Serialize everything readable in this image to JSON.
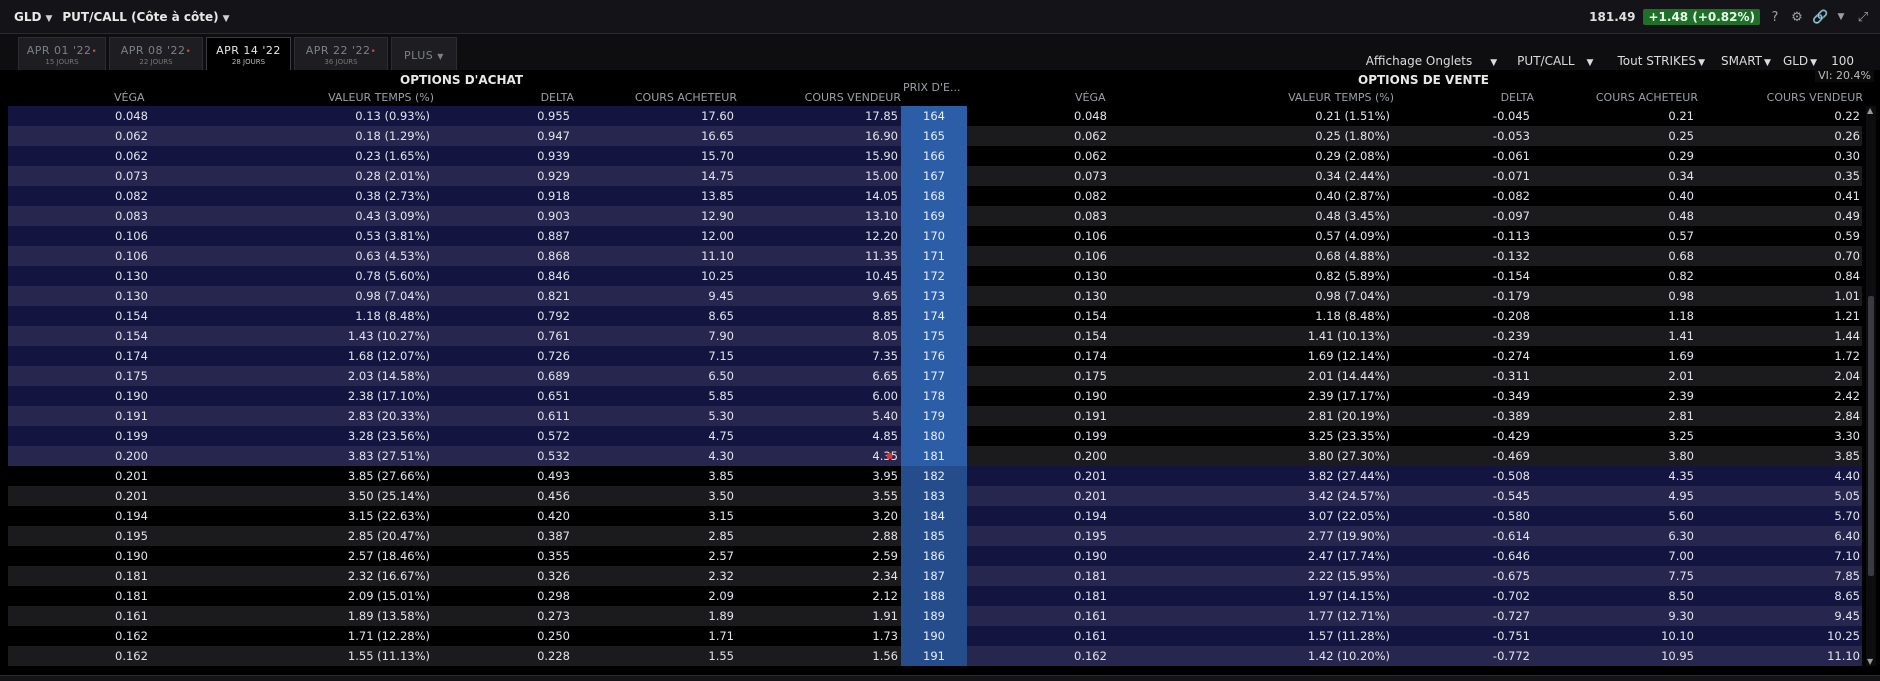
{
  "header": {
    "symbol": "GLD",
    "view": "PUT/CALL (Côte à côte)",
    "last_price": "181.49",
    "change": "+1.48",
    "change_pct": "(+0.82%)",
    "help": "?"
  },
  "tabs": [
    {
      "label": "APR 01 '22",
      "days": "15 JOURS"
    },
    {
      "label": "APR 08 '22",
      "days": "22 JOURS"
    },
    {
      "label": "APR 14 '22",
      "days": "28 JOURS"
    },
    {
      "label": "APR 22 '22",
      "days": "36 JOURS"
    }
  ],
  "more_tab": "PLUS",
  "options_bar": {
    "display": "Affichage Onglets",
    "putcall": "PUT/CALL",
    "strikes": "Tout STRIKES",
    "exchange": "SMART",
    "underlying": "GLD",
    "qty": "100",
    "vi": "VI: 20.4%"
  },
  "sections": {
    "calls": "OPTIONS D'ACHAT",
    "puts": "OPTIONS DE VENTE"
  },
  "columns": {
    "vega": "VÉGA",
    "time_value": "VALEUR TEMPS (%)",
    "delta": "DELTA",
    "bid": "COURS ACHETEUR",
    "ask": "COURS VENDEUR",
    "strike": "PRIX D'E..."
  },
  "rows": [
    {
      "strike": "164",
      "c_vega": "0.048",
      "c_tv": "0.13 (0.93%)",
      "c_delta": "0.955",
      "c_bid": "17.60",
      "c_ask": "17.85",
      "p_vega": "0.048",
      "p_tv": "0.21 (1.51%)",
      "p_delta": "-0.045",
      "p_bid": "0.21",
      "p_ask": "0.22"
    },
    {
      "strike": "165",
      "c_vega": "0.062",
      "c_tv": "0.18 (1.29%)",
      "c_delta": "0.947",
      "c_bid": "16.65",
      "c_ask": "16.90",
      "p_vega": "0.062",
      "p_tv": "0.25 (1.80%)",
      "p_delta": "-0.053",
      "p_bid": "0.25",
      "p_ask": "0.26"
    },
    {
      "strike": "166",
      "c_vega": "0.062",
      "c_tv": "0.23 (1.65%)",
      "c_delta": "0.939",
      "c_bid": "15.70",
      "c_ask": "15.90",
      "p_vega": "0.062",
      "p_tv": "0.29 (2.08%)",
      "p_delta": "-0.061",
      "p_bid": "0.29",
      "p_ask": "0.30"
    },
    {
      "strike": "167",
      "c_vega": "0.073",
      "c_tv": "0.28 (2.01%)",
      "c_delta": "0.929",
      "c_bid": "14.75",
      "c_ask": "15.00",
      "p_vega": "0.073",
      "p_tv": "0.34 (2.44%)",
      "p_delta": "-0.071",
      "p_bid": "0.34",
      "p_ask": "0.35"
    },
    {
      "strike": "168",
      "c_vega": "0.082",
      "c_tv": "0.38 (2.73%)",
      "c_delta": "0.918",
      "c_bid": "13.85",
      "c_ask": "14.05",
      "p_vega": "0.082",
      "p_tv": "0.40 (2.87%)",
      "p_delta": "-0.082",
      "p_bid": "0.40",
      "p_ask": "0.41"
    },
    {
      "strike": "169",
      "c_vega": "0.083",
      "c_tv": "0.43 (3.09%)",
      "c_delta": "0.903",
      "c_bid": "12.90",
      "c_ask": "13.10",
      "p_vega": "0.083",
      "p_tv": "0.48 (3.45%)",
      "p_delta": "-0.097",
      "p_bid": "0.48",
      "p_ask": "0.49"
    },
    {
      "strike": "170",
      "c_vega": "0.106",
      "c_tv": "0.53 (3.81%)",
      "c_delta": "0.887",
      "c_bid": "12.00",
      "c_ask": "12.20",
      "p_vega": "0.106",
      "p_tv": "0.57 (4.09%)",
      "p_delta": "-0.113",
      "p_bid": "0.57",
      "p_ask": "0.59"
    },
    {
      "strike": "171",
      "c_vega": "0.106",
      "c_tv": "0.63 (4.53%)",
      "c_delta": "0.868",
      "c_bid": "11.10",
      "c_ask": "11.35",
      "p_vega": "0.106",
      "p_tv": "0.68 (4.88%)",
      "p_delta": "-0.132",
      "p_bid": "0.68",
      "p_ask": "0.70"
    },
    {
      "strike": "172",
      "c_vega": "0.130",
      "c_tv": "0.78 (5.60%)",
      "c_delta": "0.846",
      "c_bid": "10.25",
      "c_ask": "10.45",
      "p_vega": "0.130",
      "p_tv": "0.82 (5.89%)",
      "p_delta": "-0.154",
      "p_bid": "0.82",
      "p_ask": "0.84"
    },
    {
      "strike": "173",
      "c_vega": "0.130",
      "c_tv": "0.98 (7.04%)",
      "c_delta": "0.821",
      "c_bid": "9.45",
      "c_ask": "9.65",
      "p_vega": "0.130",
      "p_tv": "0.98 (7.04%)",
      "p_delta": "-0.179",
      "p_bid": "0.98",
      "p_ask": "1.01"
    },
    {
      "strike": "174",
      "c_vega": "0.154",
      "c_tv": "1.18 (8.48%)",
      "c_delta": "0.792",
      "c_bid": "8.65",
      "c_ask": "8.85",
      "p_vega": "0.154",
      "p_tv": "1.18 (8.48%)",
      "p_delta": "-0.208",
      "p_bid": "1.18",
      "p_ask": "1.21"
    },
    {
      "strike": "175",
      "c_vega": "0.154",
      "c_tv": "1.43 (10.27%)",
      "c_delta": "0.761",
      "c_bid": "7.90",
      "c_ask": "8.05",
      "p_vega": "0.154",
      "p_tv": "1.41 (10.13%)",
      "p_delta": "-0.239",
      "p_bid": "1.41",
      "p_ask": "1.44"
    },
    {
      "strike": "176",
      "c_vega": "0.174",
      "c_tv": "1.68 (12.07%)",
      "c_delta": "0.726",
      "c_bid": "7.15",
      "c_ask": "7.35",
      "p_vega": "0.174",
      "p_tv": "1.69 (12.14%)",
      "p_delta": "-0.274",
      "p_bid": "1.69",
      "p_ask": "1.72"
    },
    {
      "strike": "177",
      "c_vega": "0.175",
      "c_tv": "2.03 (14.58%)",
      "c_delta": "0.689",
      "c_bid": "6.50",
      "c_ask": "6.65",
      "p_vega": "0.175",
      "p_tv": "2.01 (14.44%)",
      "p_delta": "-0.311",
      "p_bid": "2.01",
      "p_ask": "2.04"
    },
    {
      "strike": "178",
      "c_vega": "0.190",
      "c_tv": "2.38 (17.10%)",
      "c_delta": "0.651",
      "c_bid": "5.85",
      "c_ask": "6.00",
      "p_vega": "0.190",
      "p_tv": "2.39 (17.17%)",
      "p_delta": "-0.349",
      "p_bid": "2.39",
      "p_ask": "2.42"
    },
    {
      "strike": "179",
      "c_vega": "0.191",
      "c_tv": "2.83 (20.33%)",
      "c_delta": "0.611",
      "c_bid": "5.30",
      "c_ask": "5.40",
      "p_vega": "0.191",
      "p_tv": "2.81 (20.19%)",
      "p_delta": "-0.389",
      "p_bid": "2.81",
      "p_ask": "2.84"
    },
    {
      "strike": "180",
      "c_vega": "0.199",
      "c_tv": "3.28 (23.56%)",
      "c_delta": "0.572",
      "c_bid": "4.75",
      "c_ask": "4.85",
      "p_vega": "0.199",
      "p_tv": "3.25 (23.35%)",
      "p_delta": "-0.429",
      "p_bid": "3.25",
      "p_ask": "3.30"
    },
    {
      "strike": "181",
      "c_vega": "0.200",
      "c_tv": "3.83 (27.51%)",
      "c_delta": "0.532",
      "c_bid": "4.30",
      "c_ask": "4.35",
      "p_vega": "0.200",
      "p_tv": "3.80 (27.30%)",
      "p_delta": "-0.469",
      "p_bid": "3.80",
      "p_ask": "3.85"
    },
    {
      "strike": "182",
      "c_vega": "0.201",
      "c_tv": "3.85 (27.66%)",
      "c_delta": "0.493",
      "c_bid": "3.85",
      "c_ask": "3.95",
      "p_vega": "0.201",
      "p_tv": "3.82 (27.44%)",
      "p_delta": "-0.508",
      "p_bid": "4.35",
      "p_ask": "4.40"
    },
    {
      "strike": "183",
      "c_vega": "0.201",
      "c_tv": "3.50 (25.14%)",
      "c_delta": "0.456",
      "c_bid": "3.50",
      "c_ask": "3.55",
      "p_vega": "0.201",
      "p_tv": "3.42 (24.57%)",
      "p_delta": "-0.545",
      "p_bid": "4.95",
      "p_ask": "5.05"
    },
    {
      "strike": "184",
      "c_vega": "0.194",
      "c_tv": "3.15 (22.63%)",
      "c_delta": "0.420",
      "c_bid": "3.15",
      "c_ask": "3.20",
      "p_vega": "0.194",
      "p_tv": "3.07 (22.05%)",
      "p_delta": "-0.580",
      "p_bid": "5.60",
      "p_ask": "5.70"
    },
    {
      "strike": "185",
      "c_vega": "0.195",
      "c_tv": "2.85 (20.47%)",
      "c_delta": "0.387",
      "c_bid": "2.85",
      "c_ask": "2.88",
      "p_vega": "0.195",
      "p_tv": "2.77 (19.90%)",
      "p_delta": "-0.614",
      "p_bid": "6.30",
      "p_ask": "6.40"
    },
    {
      "strike": "186",
      "c_vega": "0.190",
      "c_tv": "2.57 (18.46%)",
      "c_delta": "0.355",
      "c_bid": "2.57",
      "c_ask": "2.59",
      "p_vega": "0.190",
      "p_tv": "2.47 (17.74%)",
      "p_delta": "-0.646",
      "p_bid": "7.00",
      "p_ask": "7.10"
    },
    {
      "strike": "187",
      "c_vega": "0.181",
      "c_tv": "2.32 (16.67%)",
      "c_delta": "0.326",
      "c_bid": "2.32",
      "c_ask": "2.34",
      "p_vega": "0.181",
      "p_tv": "2.22 (15.95%)",
      "p_delta": "-0.675",
      "p_bid": "7.75",
      "p_ask": "7.85"
    },
    {
      "strike": "188",
      "c_vega": "0.181",
      "c_tv": "2.09 (15.01%)",
      "c_delta": "0.298",
      "c_bid": "2.09",
      "c_ask": "2.12",
      "p_vega": "0.181",
      "p_tv": "1.97 (14.15%)",
      "p_delta": "-0.702",
      "p_bid": "8.50",
      "p_ask": "8.65"
    },
    {
      "strike": "189",
      "c_vega": "0.161",
      "c_tv": "1.89 (13.58%)",
      "c_delta": "0.273",
      "c_bid": "1.89",
      "c_ask": "1.91",
      "p_vega": "0.161",
      "p_tv": "1.77 (12.71%)",
      "p_delta": "-0.727",
      "p_bid": "9.30",
      "p_ask": "9.45"
    },
    {
      "strike": "190",
      "c_vega": "0.162",
      "c_tv": "1.71 (12.28%)",
      "c_delta": "0.250",
      "c_bid": "1.71",
      "c_ask": "1.73",
      "p_vega": "0.161",
      "p_tv": "1.57 (11.28%)",
      "p_delta": "-0.751",
      "p_bid": "10.10",
      "p_ask": "10.25"
    },
    {
      "strike": "191",
      "c_vega": "0.162",
      "c_tv": "1.55 (11.13%)",
      "c_delta": "0.228",
      "c_bid": "1.55",
      "c_ask": "1.56",
      "p_vega": "0.162",
      "p_tv": "1.42 (10.20%)",
      "p_delta": "-0.772",
      "p_bid": "10.95",
      "p_ask": "11.10"
    }
  ],
  "colors": {
    "itm_a": "#141440",
    "itm_b": "#26264f",
    "otm_a": "#000000",
    "otm_b": "#1b1b1e",
    "strike": "#2c5ea8"
  }
}
